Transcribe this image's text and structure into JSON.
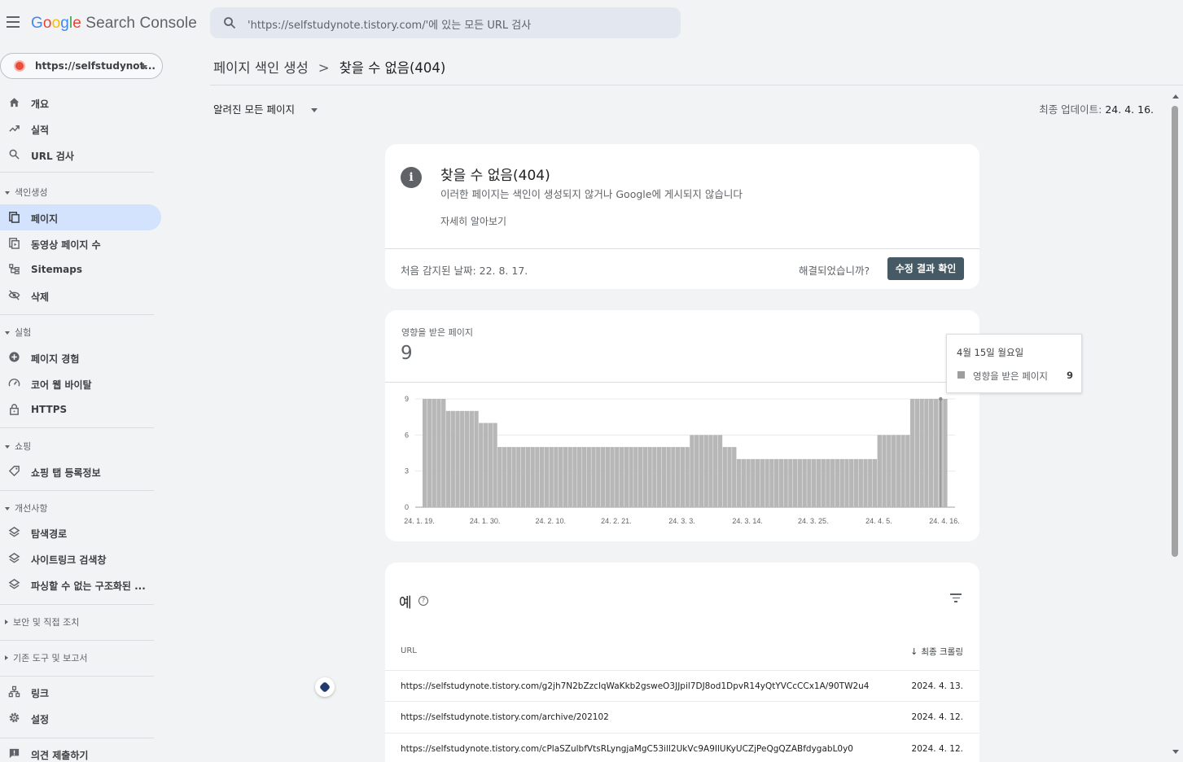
{
  "app": {
    "logo_google": "Google",
    "logo_product": "Search Console"
  },
  "search": {
    "placeholder": "'https://selfstudynote.tistory.com/'에 있는 모든 URL 검사"
  },
  "property": {
    "name": "https://selfstudynot..."
  },
  "sidebar": {
    "top_items": [
      {
        "label": "개요",
        "icon": "home-icon"
      },
      {
        "label": "실적",
        "icon": "trending-up-icon"
      },
      {
        "label": "URL 검사",
        "icon": "search-icon"
      }
    ],
    "sections": [
      {
        "label": "색인생성",
        "items": [
          {
            "label": "페이지",
            "icon": "pages-icon"
          },
          {
            "label": "동영상 페이지 수",
            "icon": "video-pages-icon"
          },
          {
            "label": "Sitemaps",
            "icon": "sitemap-icon"
          },
          {
            "label": "삭제",
            "icon": "visibility-off-icon"
          }
        ]
      },
      {
        "label": "실험",
        "items": [
          {
            "label": "페이지 경험",
            "icon": "add-circle-icon"
          },
          {
            "label": "코어 웹 바이탈",
            "icon": "speed-icon"
          },
          {
            "label": "HTTPS",
            "icon": "lock-icon"
          }
        ]
      },
      {
        "label": "쇼핑",
        "items": [
          {
            "label": "쇼핑 탭 등록정보",
            "icon": "tag-icon"
          }
        ]
      },
      {
        "label": "개선사항",
        "items": [
          {
            "label": "탐색경로",
            "icon": "layers-icon"
          },
          {
            "label": "사이트링크 검색창",
            "icon": "layers-icon"
          },
          {
            "label": "파싱할 수 없는 구조화된 ...",
            "icon": "layers-icon"
          }
        ]
      }
    ],
    "collapsed_sections": [
      "보안 및 직접 조치",
      "기존 도구 및 보고서"
    ],
    "bottom_items": [
      {
        "label": "링크",
        "icon": "links-icon"
      },
      {
        "label": "설정",
        "icon": "settings-icon"
      },
      {
        "label": "의견 제출하기",
        "icon": "feedback-icon"
      }
    ]
  },
  "breadcrumb": {
    "parent": "페이지 색인 생성",
    "separator": ">",
    "current": "찾을 수 없음(404)"
  },
  "filter": {
    "selected": "알려진 모든 페이지"
  },
  "updated": {
    "label": "최종 업데이트:",
    "value": "24. 4. 16."
  },
  "issue_card": {
    "title": "찾을 수 없음(404)",
    "description": "이러한 페이지는 색인이 생성되지 않거나 Google에 게시되지 않습니다",
    "learn_more": "자세히 알아보기",
    "first_detected": "처음 감지된 날짜: 22. 8. 17.",
    "resolved_question": "해결되었습니까?",
    "validate_button": "수정 결과 확인"
  },
  "affected_card": {
    "label": "영향을 받은 페이지",
    "value": "9"
  },
  "tooltip": {
    "date": "4월 15일 월요일",
    "series_name": "영향을 받은 페이지",
    "value": "9"
  },
  "chart_data": {
    "type": "bar",
    "series": [
      {
        "name": "영향을 받은 페이지",
        "values": [
          9,
          9,
          9,
          9,
          9,
          8,
          8,
          8,
          8,
          8,
          8,
          8,
          7,
          7,
          7,
          7,
          5,
          5,
          5,
          5,
          5,
          5,
          5,
          5,
          5,
          5,
          5,
          5,
          5,
          5,
          5,
          5,
          5,
          5,
          5,
          5,
          5,
          5,
          5,
          5,
          5,
          5,
          5,
          5,
          5,
          5,
          5,
          5,
          5,
          5,
          5,
          5,
          5,
          5,
          5,
          5,
          5,
          6,
          6,
          6,
          6,
          6,
          6,
          6,
          5,
          5,
          5,
          4,
          4,
          4,
          4,
          4,
          4,
          4,
          4,
          4,
          4,
          4,
          4,
          4,
          4,
          4,
          4,
          4,
          4,
          4,
          4,
          4,
          4,
          4,
          4,
          4,
          4,
          4,
          4,
          4,
          4,
          6,
          6,
          6,
          6,
          6,
          6,
          6,
          9,
          9,
          9,
          9,
          9,
          9,
          9,
          9
        ]
      }
    ],
    "x_ticks": [
      "24. 1. 19.",
      "24. 1. 30.",
      "24. 2. 10.",
      "24. 2. 21.",
      "24. 3. 3.",
      "24. 3. 14.",
      "24. 3. 25.",
      "24. 4. 5.",
      "24. 4. 16."
    ],
    "y_ticks": [
      "0",
      "3",
      "6",
      "9"
    ],
    "ylim": [
      0,
      9
    ],
    "grid": true,
    "color": "#b7b7b7",
    "highlighted_date": "4월 15일 월요일"
  },
  "examples": {
    "title": "예",
    "col_url": "URL",
    "col_crawl": "최종 크롤링",
    "rows": [
      {
        "url": "https://selfstudynote.tistory.com/g2jh7N2bZzclqWaKkb2gsweO3JJpil7DJ8od1DpvR14yQtYVCcCCx1A/90TW2u4",
        "date": "2024. 4. 13."
      },
      {
        "url": "https://selfstudynote.tistory.com/archive/202102",
        "date": "2024. 4. 12."
      },
      {
        "url": "https://selfstudynote.tistory.com/cPlaSZulbfVtsRLyngjaMgC53ill2UkVc9A9IlUKyUCZjPeQgQZABfdygabL0y0",
        "date": "2024. 4. 12."
      }
    ]
  }
}
